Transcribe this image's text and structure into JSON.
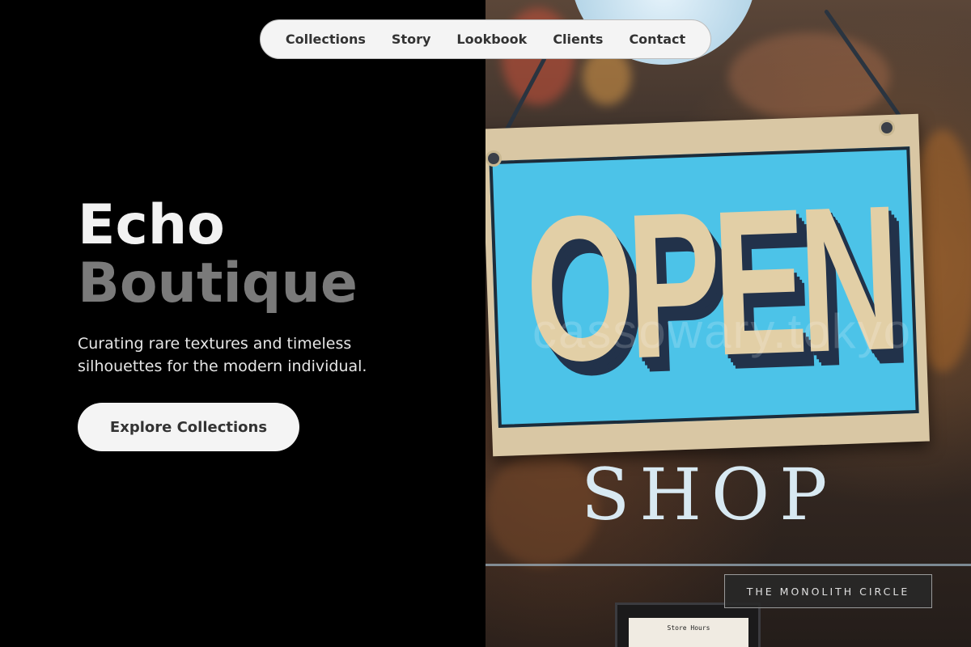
{
  "nav": {
    "items": [
      "Collections",
      "Story",
      "Lookbook",
      "Clients",
      "Contact"
    ]
  },
  "hero": {
    "title_line1": "Echo",
    "title_line2": "Boutique",
    "subtitle": "Curating rare textures and timeless silhouettes for the modern individual.",
    "cta_label": "Explore Collections"
  },
  "photo": {
    "sign_text": "OPEN",
    "door_text": "SHOP",
    "watermark": "cassowary.tokyo",
    "hours_text": "Store Hours"
  },
  "badge": {
    "label": "THE MONOLITH CIRCLE"
  },
  "colors": {
    "background": "#000000",
    "nav_bg": "#f4f4f4",
    "title_primary": "#f2f2f2",
    "title_secondary": "#7a7a7a",
    "sign_blue": "#4cc3e8",
    "sign_cream": "#e2cfa6"
  }
}
